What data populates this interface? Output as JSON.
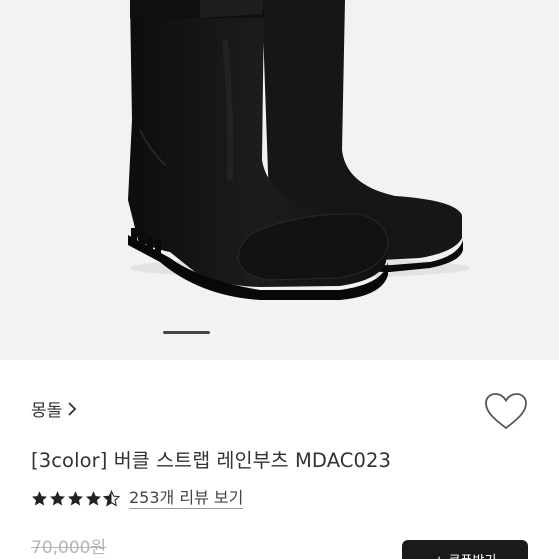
{
  "product": {
    "brand": "몽돌",
    "title": "[3color] 버클 스트랩 레인부츠 MDAC023",
    "rating": 4.5,
    "rating_max": 5,
    "reviews_label": "253개 리뷰 보기",
    "original_price": "70,000원",
    "coupon_button_label": "+ 쿠폰받기"
  },
  "gallery": {
    "total_slides": 2,
    "active_slide": 1
  },
  "colors": {
    "background_gallery": "#f2f2f2",
    "boot": "#151515",
    "button": "#1a1a1a",
    "strike_price": "#b5b5b5"
  },
  "icons": {
    "brand_link": "chevron-right-icon",
    "wishlist": "heart-outline-icon",
    "rating": "star-icon"
  }
}
